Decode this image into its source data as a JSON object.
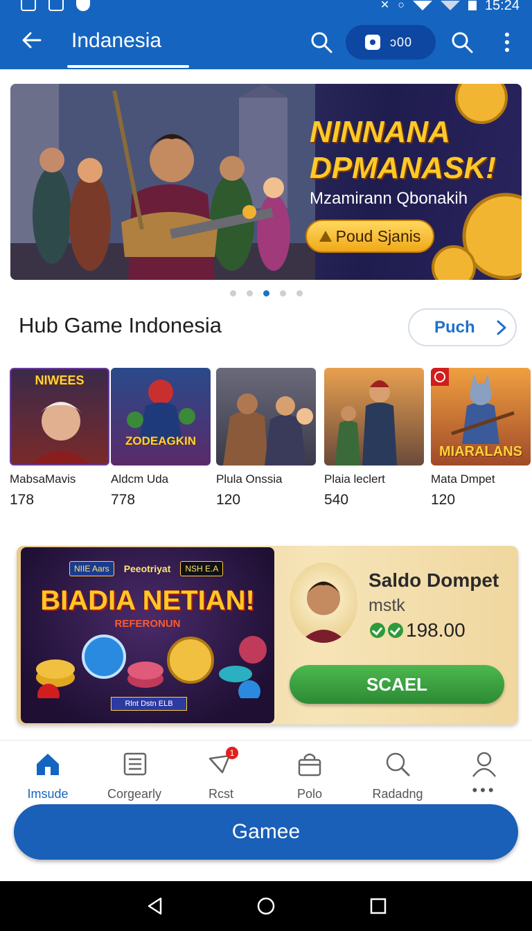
{
  "status_bar": {
    "time": "15:24"
  },
  "app_bar": {
    "title": "Indanesia",
    "coin_value": "ɔ00"
  },
  "banner": {
    "headline_line1": "NINNANA",
    "headline_line2": "DPMANASK!",
    "subtitle": "Mzamirann Qbonakih",
    "cta_label": "Poud Sjanis",
    "pages": 5,
    "active_page": 3
  },
  "section": {
    "title": "Hub Game Indonesia",
    "action_label": "Puch"
  },
  "games": [
    {
      "brand": "NIWEES",
      "name": "MabsaMavis",
      "count": "178"
    },
    {
      "brand": "ZODEAGKIN",
      "name": "Aldcm Uda",
      "count": "778"
    },
    {
      "brand": "",
      "name": "Plula Onssia",
      "count": "120"
    },
    {
      "brand": "",
      "name": "Plaia leclert",
      "count": "540"
    },
    {
      "brand": "MIARALANS",
      "name": "Mata Dmpet",
      "count": "120"
    }
  ],
  "promo": {
    "chips": [
      "NIIE Aars",
      "Peeotriyat",
      "NSH E.A"
    ],
    "big_text": "BIADIA NETIAN!",
    "small_text": "REFERONUN",
    "footer_text": "Rlnt Dstn ELB",
    "wallet_title": "Saldo Dompet",
    "wallet_sub": "mstk",
    "wallet_amount": "198.00",
    "button_label": "SCAEL"
  },
  "bottom_nav": [
    {
      "label": "Imsude",
      "active": true
    },
    {
      "label": "Corgearly",
      "active": false
    },
    {
      "label": "Rcst",
      "active": false,
      "badge": "1"
    },
    {
      "label": "Polo",
      "active": false
    },
    {
      "label": "Radadng",
      "active": false
    },
    {
      "label": "",
      "active": false
    }
  ],
  "primary_button": {
    "label": "Gamee"
  },
  "colors": {
    "primary": "#1565c0",
    "accent_gold": "#ffc928",
    "success": "#2e9a3a"
  }
}
